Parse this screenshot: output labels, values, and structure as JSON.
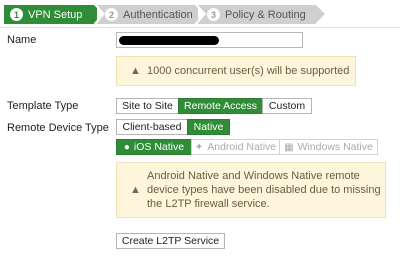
{
  "wizard": {
    "steps": [
      {
        "num": "1",
        "label": "VPN Setup"
      },
      {
        "num": "2",
        "label": "Authentication"
      },
      {
        "num": "3",
        "label": "Policy & Routing"
      }
    ]
  },
  "form": {
    "name_label": "Name",
    "name_value": "",
    "capacity_note": "1000 concurrent user(s) will be supported",
    "template_type_label": "Template Type",
    "template_options": [
      "Site to Site",
      "Remote Access",
      "Custom"
    ],
    "template_selected": "Remote Access",
    "remote_device_type_label": "Remote Device Type",
    "device_options": [
      "Client-based",
      "Native"
    ],
    "device_selected": "Native",
    "native_options": [
      {
        "label": "iOS Native",
        "icon": "apple-icon",
        "state": "active"
      },
      {
        "label": "Android Native",
        "icon": "android-icon",
        "state": "disabled"
      },
      {
        "label": "Windows Native",
        "icon": "windows-icon",
        "state": "disabled"
      }
    ],
    "disabled_note_lines": [
      "Android Native and Windows Native remote",
      "device types have been disabled due to missing",
      "the L2TP firewall service."
    ],
    "create_button": "Create L2TP Service"
  },
  "colors": {
    "accent_green": "#2f8d37",
    "note_bg": "#fdf6dd",
    "step_inactive": "#cfcfcf"
  }
}
